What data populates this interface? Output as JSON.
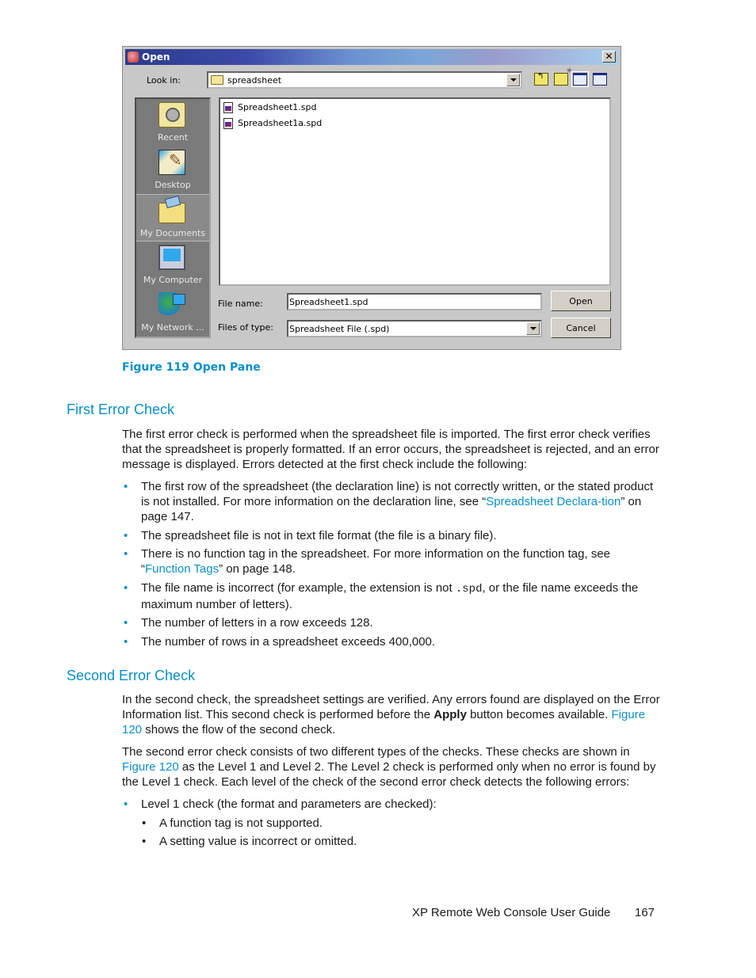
{
  "dialog": {
    "title": "Open",
    "close_label": "✕",
    "look_in_label": "Look in:",
    "look_in_value": "spreadsheet",
    "places": [
      {
        "label": "Recent",
        "icon": "recent-folder-icon"
      },
      {
        "label": "Desktop",
        "icon": "desktop-icon"
      },
      {
        "label": "My Documents",
        "icon": "my-documents-icon"
      },
      {
        "label": "My Computer",
        "icon": "my-computer-icon"
      },
      {
        "label": "My Network ...",
        "icon": "network-icon"
      }
    ],
    "files": [
      "Spreadsheet1.spd",
      "Spreadsheet1a.spd"
    ],
    "file_name_label": "File name:",
    "file_name_value": "Spreadsheet1.spd",
    "files_of_type_label": "Files of type:",
    "files_of_type_value": "Spreadsheet File (.spd)",
    "open_button": "Open",
    "cancel_button": "Cancel",
    "toolbar_icons": [
      "up-one-level-icon",
      "create-new-folder-icon",
      "list-view-icon",
      "details-view-icon"
    ]
  },
  "figure_caption": "Figure 119 Open Pane",
  "section1": {
    "heading": "First Error Check",
    "intro": "The first error check is performed when the spreadsheet file is imported. The first error check verifies that the spreadsheet is properly formatted. If an error occurs, the spreadsheet is rejected, and an error message is displayed. Errors detected at the first check include the following:",
    "bullets": [
      {
        "pre": "The first row of the spreadsheet (the declaration line) is not correctly written, or the stated product is not installed. For more information on the declaration line, see “",
        "link": "Spreadsheet Declara-tion",
        "post": "” on page 147."
      },
      {
        "text": "The spreadsheet file is not in text file format (the file is a binary file)."
      },
      {
        "pre": "There is no function tag in the spreadsheet. For more information on the function tag, see “",
        "link": "Function Tags",
        "post": "” on page 148."
      },
      {
        "pre": "The file name is incorrect (for example, the extension is not ",
        "code": ".spd",
        "post": ", or the file name exceeds the maximum number of letters)."
      },
      {
        "text": "The number of letters in a row exceeds 128."
      },
      {
        "text": "The number of rows in a spreadsheet exceeds 400,000."
      }
    ]
  },
  "section2": {
    "heading": "Second Error Check",
    "p1_pre": "In the second check, the spreadsheet settings are verified. Any errors found are displayed on the Error Information list. This second check is performed before the ",
    "p1_bold": "Apply",
    "p1_mid": " button becomes available. ",
    "p1_link": "Figure 120",
    "p1_post": " shows the flow of the second check.",
    "p2_pre": "The second error check consists of two different types of the checks. These checks are shown in ",
    "p2_link": "Figure 120",
    "p2_post": " as the Level 1 and Level 2. The Level 2 check is performed only when no error is found by the Level 1 check. Each level of the check of the second error check detects the following errors:",
    "bullet": "Level 1 check (the format and parameters are checked):",
    "sub_bullets": [
      "A function tag is not supported.",
      "A setting value is incorrect or omitted."
    ]
  },
  "footer": {
    "title": "XP Remote Web Console User Guide",
    "page": "167"
  },
  "colors": {
    "accent": "#0a8fc8",
    "text": "#1a1a1a"
  }
}
